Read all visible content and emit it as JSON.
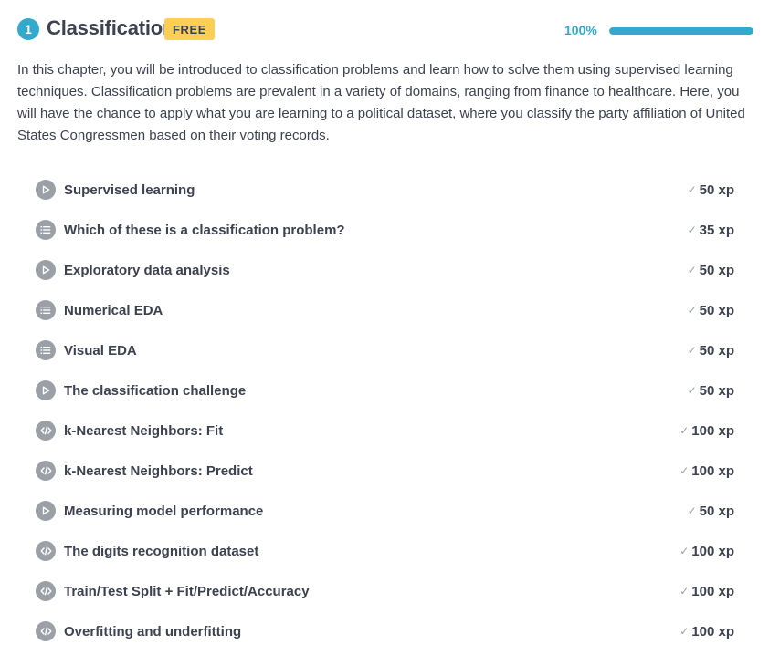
{
  "chapter": {
    "number": "1",
    "title": "Classification",
    "badge": "FREE",
    "progress_label": "100%",
    "progress_fraction": 1.0,
    "description": "In this chapter, you will be introduced to classification problems and learn how to solve them using supervised learning techniques. Classification problems are prevalent in a variety of domains, ranging from finance to healthcare. Here, you will have the chance to apply what you are learning to a political dataset, where you classify the party affiliation of United States Congressmen based on their voting records."
  },
  "colors": {
    "accent": "#33aacc",
    "badge": "#fcce54",
    "icon_gray": "#9aa0a6",
    "text": "#3d4251"
  },
  "exercises": [
    {
      "type": "video",
      "icon": "play-icon",
      "title": "Supervised learning",
      "xp": "50 xp"
    },
    {
      "type": "multiple-choice",
      "icon": "list-icon",
      "title": "Which of these is a classification problem?",
      "xp": "35 xp"
    },
    {
      "type": "video",
      "icon": "play-icon",
      "title": "Exploratory data analysis",
      "xp": "50 xp"
    },
    {
      "type": "multiple-choice",
      "icon": "list-icon",
      "title": "Numerical EDA",
      "xp": "50 xp"
    },
    {
      "type": "multiple-choice",
      "icon": "list-icon",
      "title": "Visual EDA",
      "xp": "50 xp"
    },
    {
      "type": "video",
      "icon": "play-icon",
      "title": "The classification challenge",
      "xp": "50 xp"
    },
    {
      "type": "code",
      "icon": "code-icon",
      "title": "k-Nearest Neighbors: Fit",
      "xp": "100 xp"
    },
    {
      "type": "code",
      "icon": "code-icon",
      "title": "k-Nearest Neighbors: Predict",
      "xp": "100 xp"
    },
    {
      "type": "video",
      "icon": "play-icon",
      "title": "Measuring model performance",
      "xp": "50 xp"
    },
    {
      "type": "code",
      "icon": "code-icon",
      "title": "The digits recognition dataset",
      "xp": "100 xp"
    },
    {
      "type": "code",
      "icon": "code-icon",
      "title": "Train/Test Split + Fit/Predict/Accuracy",
      "xp": "100 xp"
    },
    {
      "type": "code",
      "icon": "code-icon",
      "title": "Overfitting and underfitting",
      "xp": "100 xp"
    }
  ]
}
